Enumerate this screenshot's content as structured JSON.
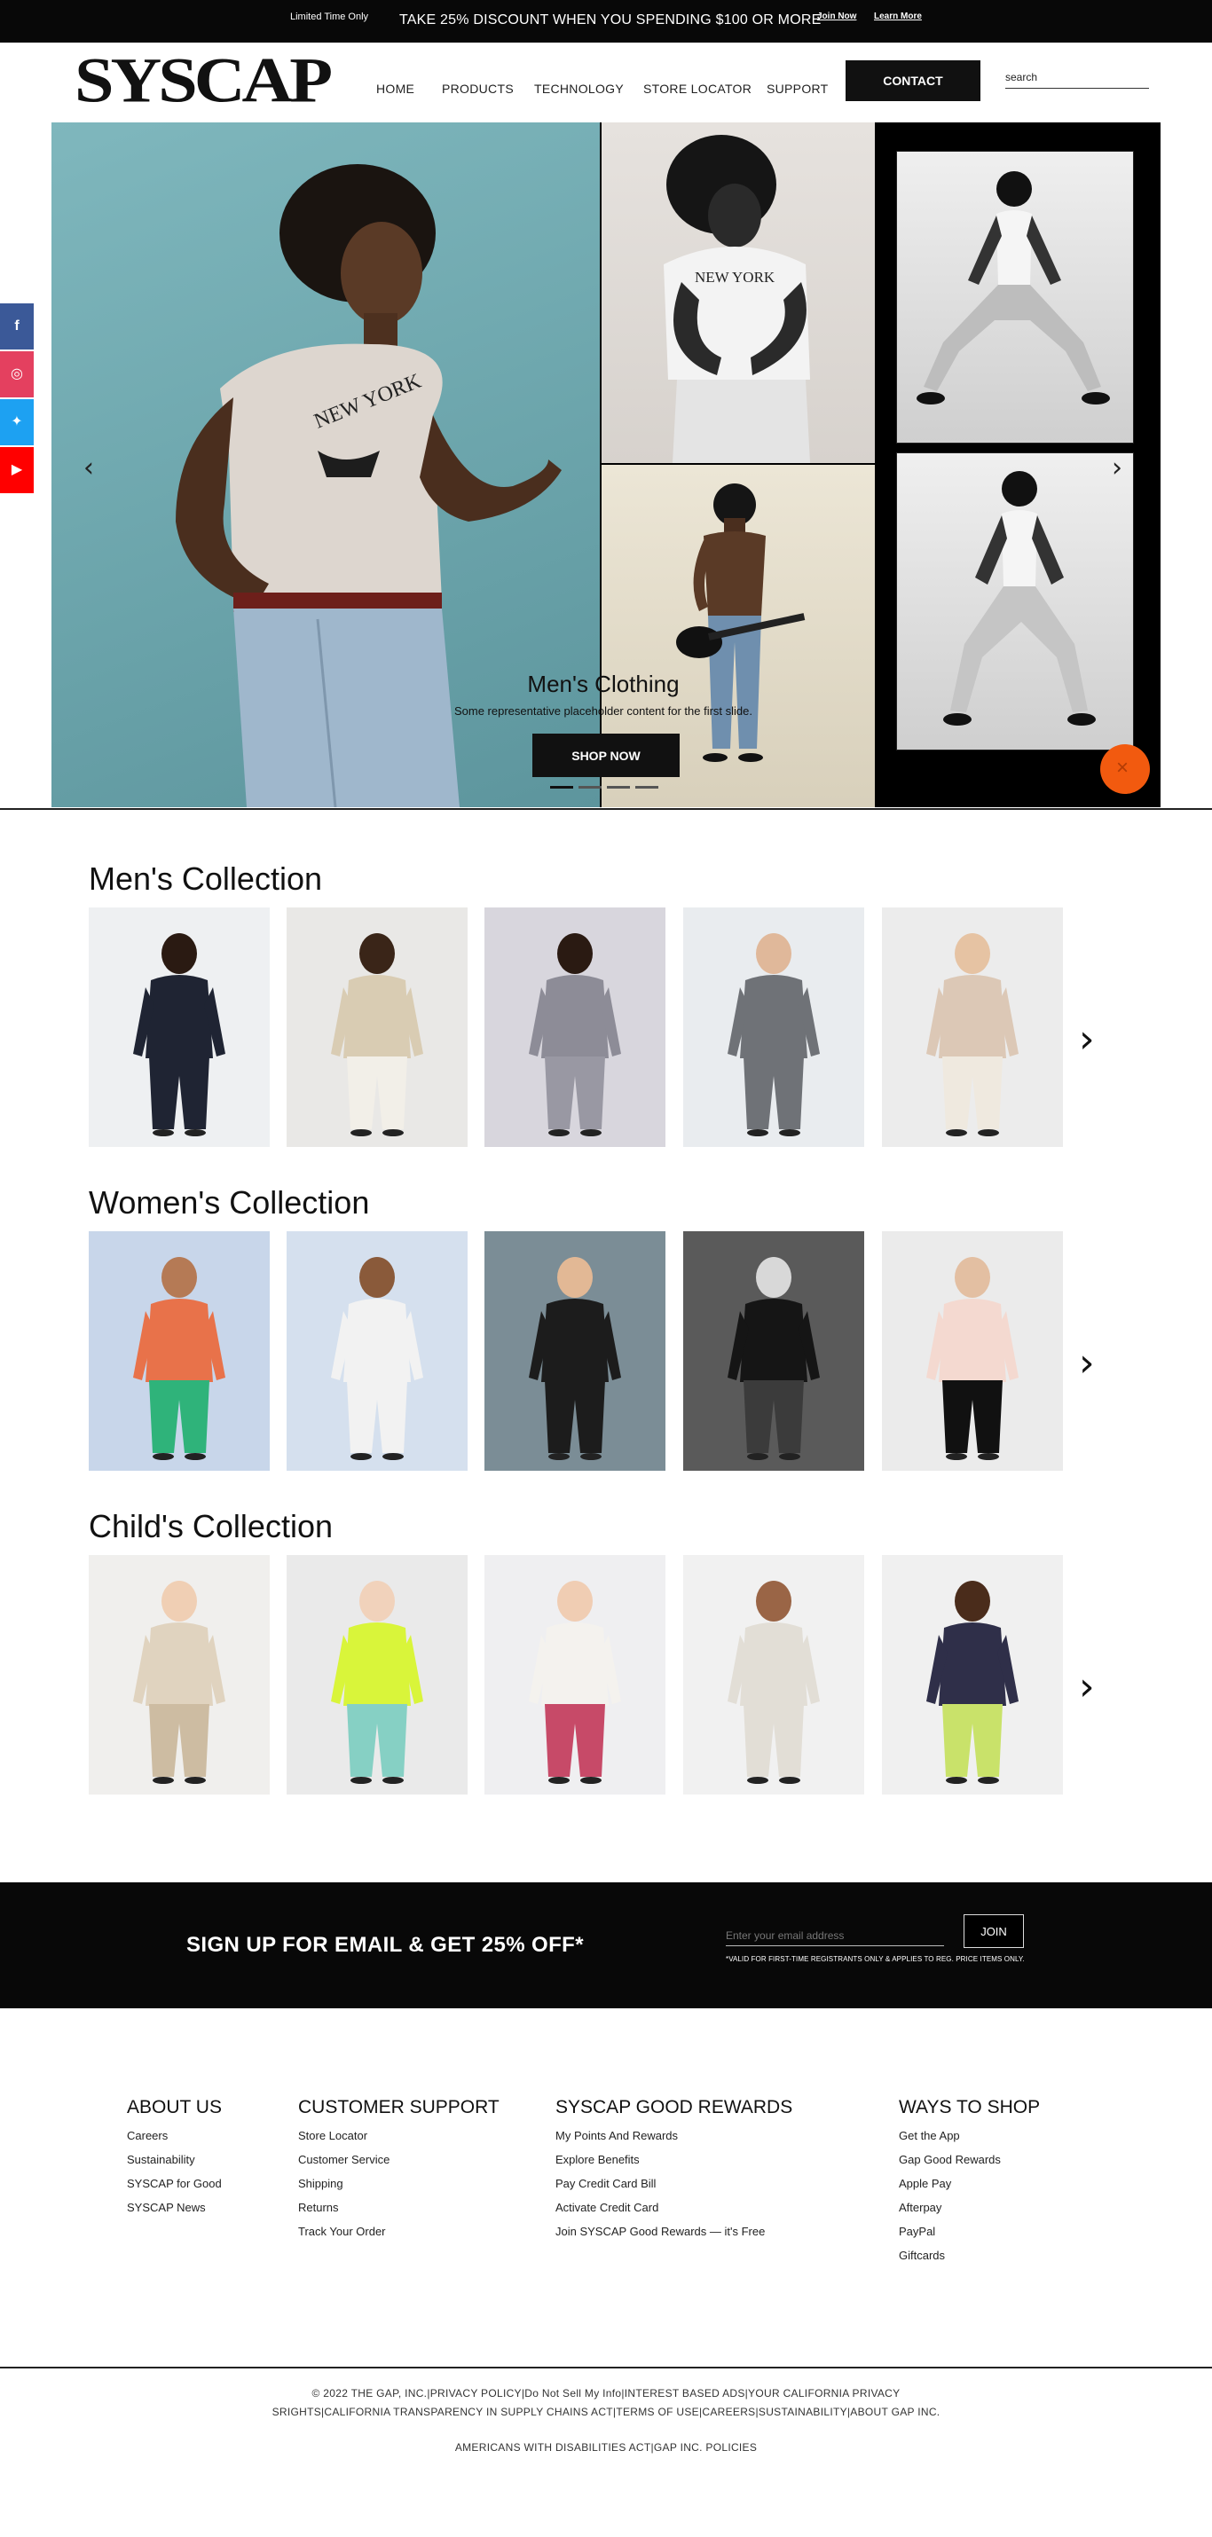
{
  "promo": {
    "limited": "Limited Time Only",
    "offer": "TAKE 25% DISCOUNT WHEN YOU SPENDING $100 OR MORE",
    "join_link": "Join Now",
    "learn_link": "Learn More"
  },
  "header": {
    "logo": "SYSCAP",
    "nav": [
      "HOME",
      "PRODUCTS",
      "TECHNOLOGY",
      "STORE LOCATOR",
      "SUPPORT"
    ],
    "contact_label": "CONTACT",
    "search_placeholder": "search"
  },
  "hero": {
    "title": "Men's Clothing",
    "subtitle": "Some representative placeholder content for the first slide.",
    "button": "SHOP NOW",
    "prev_glyph": "‹",
    "next_glyph": "›",
    "slide_count": 4,
    "active_slide": 1,
    "close_glyph": "×",
    "shirt_print": "NEW YORK"
  },
  "social": [
    {
      "icon": "facebook-icon",
      "glyph": "f",
      "color": "#3b5998"
    },
    {
      "icon": "instagram-icon",
      "glyph": "◎",
      "color": "#e4405f"
    },
    {
      "icon": "twitter-icon",
      "glyph": "✦",
      "color": "#1da1f2"
    },
    {
      "icon": "youtube-icon",
      "glyph": "▶",
      "color": "#ff0000"
    }
  ],
  "collections": [
    {
      "title": "Men's Collection"
    },
    {
      "title": "Women's Collection"
    },
    {
      "title": "Child's Collection"
    }
  ],
  "signup": {
    "title": "SIGN UP FOR EMAIL & GET 25% OFF*",
    "placeholder": "Enter your email address",
    "button": "JOIN",
    "note": "*VALID FOR FIRST-TIME REGISTRANTS ONLY & APPLIES TO REG. PRICE ITEMS ONLY."
  },
  "footer": {
    "columns": [
      {
        "title": "ABOUT US",
        "links": [
          "Careers",
          "Sustainability",
          "SYSCAP for Good",
          "SYSCAP News"
        ]
      },
      {
        "title": "CUSTOMER SUPPORT",
        "links": [
          "Store Locator",
          "Customer Service",
          "Shipping",
          "Returns",
          "Track Your Order"
        ]
      },
      {
        "title": "SYSCAP GOOD REWARDS",
        "links": [
          "My Points And Rewards",
          "Explore Benefits",
          "Pay Credit Card Bill",
          "Activate Credit Card",
          "Join SYSCAP Good Rewards — it's Free"
        ]
      },
      {
        "title": "WAYS TO SHOP",
        "links": [
          "Get the App",
          "Gap Good Rewards",
          "Apple Pay",
          "Afterpay",
          "PayPal",
          "Giftcards"
        ]
      }
    ],
    "legal_line1": "© 2022 THE GAP, INC.|PRIVACY POLICY|Do Not Sell My Info|INTEREST BASED ADS|YOUR CALIFORNIA PRIVACY",
    "legal_line2": "SRIGHTS|CALIFORNIA TRANSPARENCY IN SUPPLY CHAINS ACT|TERMS OF USE|CAREERS|SUSTAINABILITY|ABOUT GAP INC.",
    "legal_line3": "AMERICANS WITH DISABILITIES ACT|GAP INC. POLICIES"
  }
}
